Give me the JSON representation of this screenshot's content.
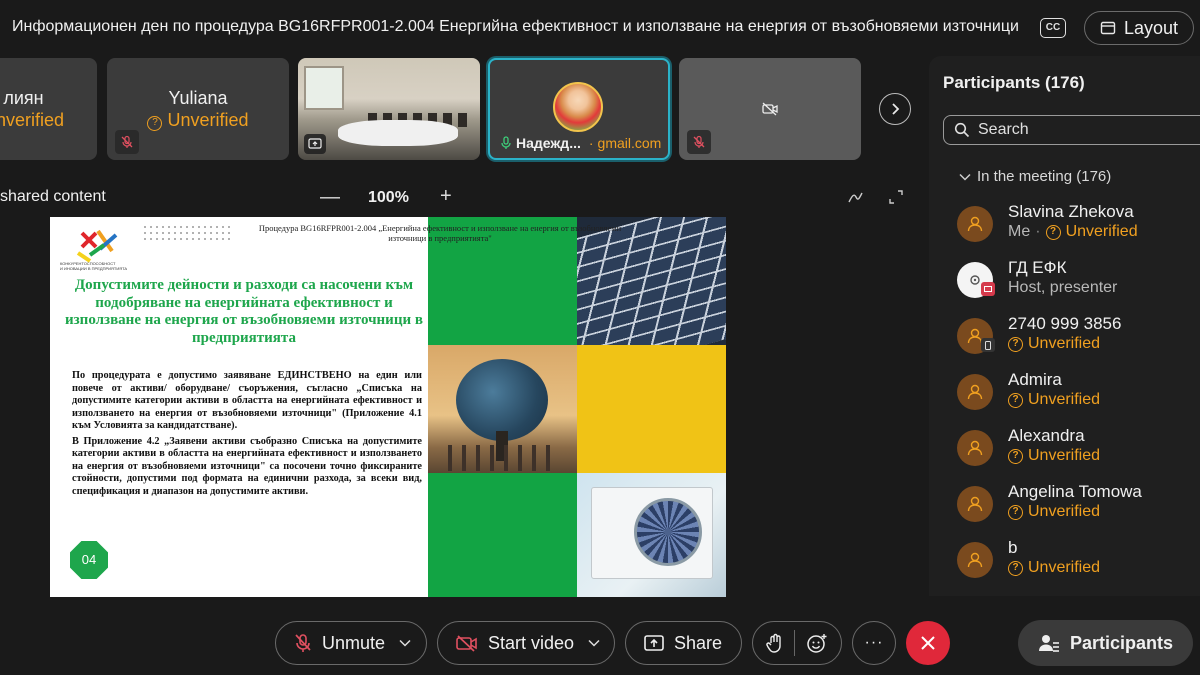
{
  "meeting": {
    "title": "Информационен ден по процедура BG16RFPR001-2.004 Енергийна ефективност и използване на енергия от възобновяеми източници",
    "cc_label": "CC",
    "layout_label": "Layout"
  },
  "video_strip": {
    "tiles": [
      {
        "name": "лиян",
        "status": "Unverified"
      },
      {
        "name": "Yuliana",
        "status": "Unverified"
      },
      {
        "name": "",
        "status": ""
      },
      {
        "name": "Надежд...",
        "email": "gmail.com"
      },
      {
        "name": "",
        "status": ""
      }
    ]
  },
  "shared_content": {
    "label": "shared content",
    "zoom": "100%",
    "zoom_minus": "—",
    "zoom_plus": "+"
  },
  "slide": {
    "header": "Процедура BG16RFPR001-2.004 „Енергийна ефективност и използване на енергия от възобновяеми източници в предприятията\"",
    "heading": "Допустимите дейности и разходи са насочени към подобряване на енергийната ефективност и използване на енергия от възобновяеми източници в предприятията",
    "para1": "По процедурата е допустимо заявяване ЕДИНСТВЕНО на един или повече от активи/ оборудване/ съоръжения, съгласно „Списъка на допустимите категории активи в областта на енергийната ефективност и използването на енергия от възобновяеми източници\" (Приложение 4.1 към Условията за кандидатстване).",
    "para2": "В Приложение 4.2 „Заявени активи съобразно Списъка на допустимите категории активи в областта на енергийната ефективност и използването на енергия от възобновяеми източници\" са посочени точно фиксираните стойности, допустими под формата на единични разхода, за всеки вид, спецификация и диапазон на допустимите активи.",
    "page": "04"
  },
  "panel": {
    "title": "Participants (176)",
    "search_placeholder": "Search",
    "section": "In the meeting (176)",
    "participants": [
      {
        "name": "Slavina Zhekova",
        "me": "Me",
        "status": "Unverified"
      },
      {
        "name": "ГД ЕФК",
        "role": "Host, presenter"
      },
      {
        "name": "2740 999 3856",
        "status": "Unverified"
      },
      {
        "name": "Admira",
        "status": "Unverified"
      },
      {
        "name": "Alexandra",
        "status": "Unverified"
      },
      {
        "name": "Angelina Tomowa",
        "status": "Unverified"
      },
      {
        "name": "b",
        "status": "Unverified"
      }
    ]
  },
  "toolbar": {
    "unmute": "Unmute",
    "start_video": "Start video",
    "share": "Share",
    "participants": "Participants",
    "more": "···"
  }
}
